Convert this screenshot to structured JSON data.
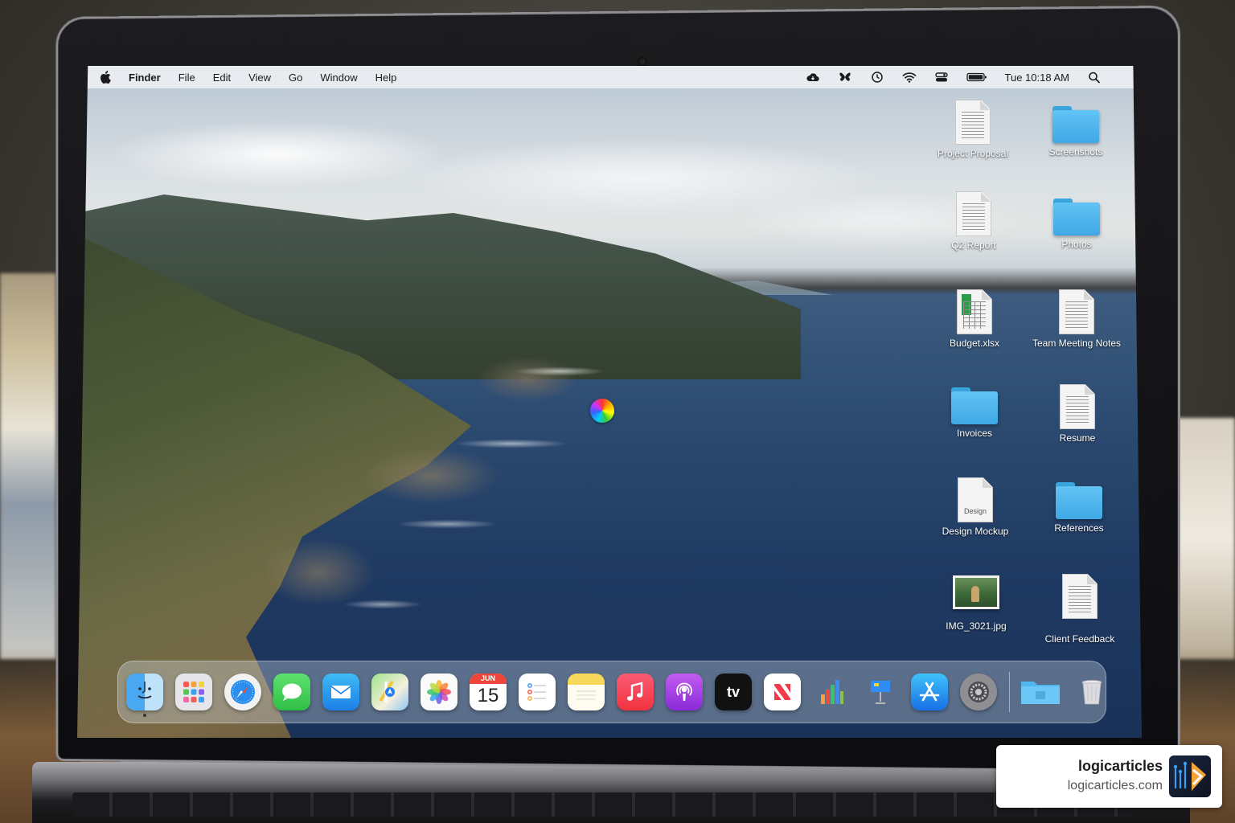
{
  "menubar": {
    "app_name": "Finder",
    "menus": [
      "File",
      "Edit",
      "View",
      "Go",
      "Window",
      "Help"
    ],
    "clock": "Tue 10:18 AM",
    "status_icons": [
      "icloud-icon",
      "butterfly-icon",
      "clock-icon",
      "wifi-icon",
      "control-center-icon",
      "battery-icon",
      "spotlight-search-icon"
    ]
  },
  "desktop": {
    "items": [
      {
        "label": "Project Proposal",
        "type": "document"
      },
      {
        "label": "Screenshots",
        "type": "folder"
      },
      {
        "label": "Q2 Report",
        "type": "document"
      },
      {
        "label": "Photos",
        "type": "folder"
      },
      {
        "label": "Budget.xlsx",
        "type": "spreadsheet"
      },
      {
        "label": "Team Meeting Notes",
        "type": "document"
      },
      {
        "label": "Invoices",
        "type": "folder"
      },
      {
        "label": "Resume",
        "type": "document"
      },
      {
        "label": "Design Mockup",
        "type": "document",
        "thumb_text": "Design"
      },
      {
        "label": "References",
        "type": "folder"
      },
      {
        "label": "IMG_3021.jpg",
        "type": "image"
      },
      {
        "label": "Client Feedback",
        "type": "document"
      }
    ]
  },
  "dock": {
    "apps": [
      "finder-icon",
      "launchpad-icon",
      "safari-icon",
      "messages-icon",
      "mail-icon",
      "maps-icon",
      "photos-icon",
      "calendar-icon",
      "reminders-icon",
      "notes-icon",
      "music-icon",
      "podcasts-icon",
      "apple-tv-icon",
      "news-icon",
      "numbers-icon",
      "keynote-icon",
      "app-store-icon",
      "system-settings-icon"
    ],
    "calendar_month": "JUN",
    "calendar_day": "15",
    "tv_label": "tv",
    "extras": [
      "downloads-folder-icon",
      "trash-icon"
    ]
  },
  "badge": {
    "name": "logicarticles",
    "url": "logicarticles.com"
  },
  "colors": {
    "folder": "#4fb6ee",
    "menubar": "#eceef1",
    "ocean": "#2e4d73"
  }
}
